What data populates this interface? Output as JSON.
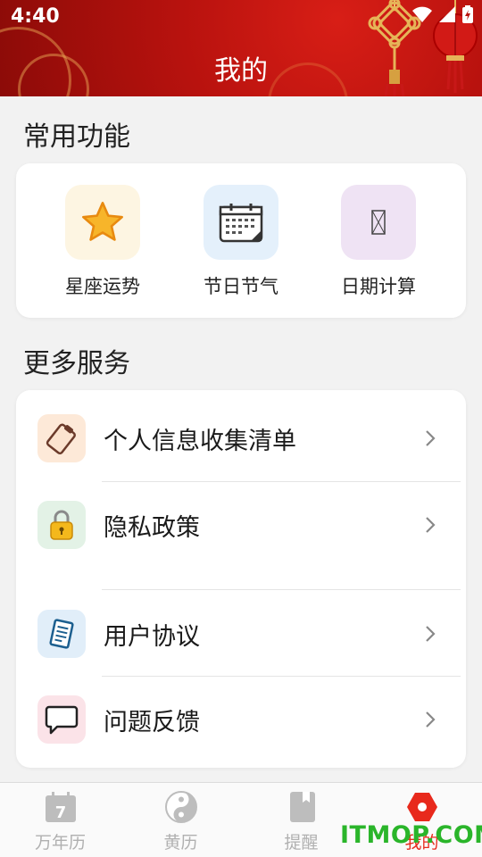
{
  "status": {
    "time": "4:40"
  },
  "header": {
    "title": "我的"
  },
  "sections": {
    "common": "常用功能",
    "more": "更多服务"
  },
  "features": [
    {
      "label": "星座运势",
      "icon": "star-icon",
      "tile_color": "#fdf5e2"
    },
    {
      "label": "节日节气",
      "icon": "calendar-icon",
      "tile_color": "#e4f0fb"
    },
    {
      "label": "日期计算",
      "icon": "missing-glyph-icon",
      "tile_color": "#efe3f4"
    }
  ],
  "services": [
    {
      "label": "个人信息收集清单",
      "icon": "clipboard-icon",
      "tile_color": "#fde9d8"
    },
    {
      "label": "隐私政策",
      "icon": "lock-icon",
      "tile_color": "#e3f2e6"
    },
    {
      "label": "用户协议",
      "icon": "document-icon",
      "tile_color": "#e1eef9"
    },
    {
      "label": "问题反馈",
      "icon": "chat-bubble-icon",
      "tile_color": "#fbe3e8"
    }
  ],
  "tabs": [
    {
      "label": "万年历",
      "icon": "calendar-7-icon",
      "badge": "7",
      "active": false
    },
    {
      "label": "黄历",
      "icon": "yin-yang-icon",
      "active": false
    },
    {
      "label": "提醒",
      "icon": "bookmark-icon",
      "active": false
    },
    {
      "label": "我的",
      "icon": "hexagon-icon",
      "active": true
    }
  ],
  "watermark": "ITMOP.COM",
  "colors": {
    "accent": "#e8291c",
    "header_red": "#c01510",
    "watermark": "#2ab52a"
  }
}
